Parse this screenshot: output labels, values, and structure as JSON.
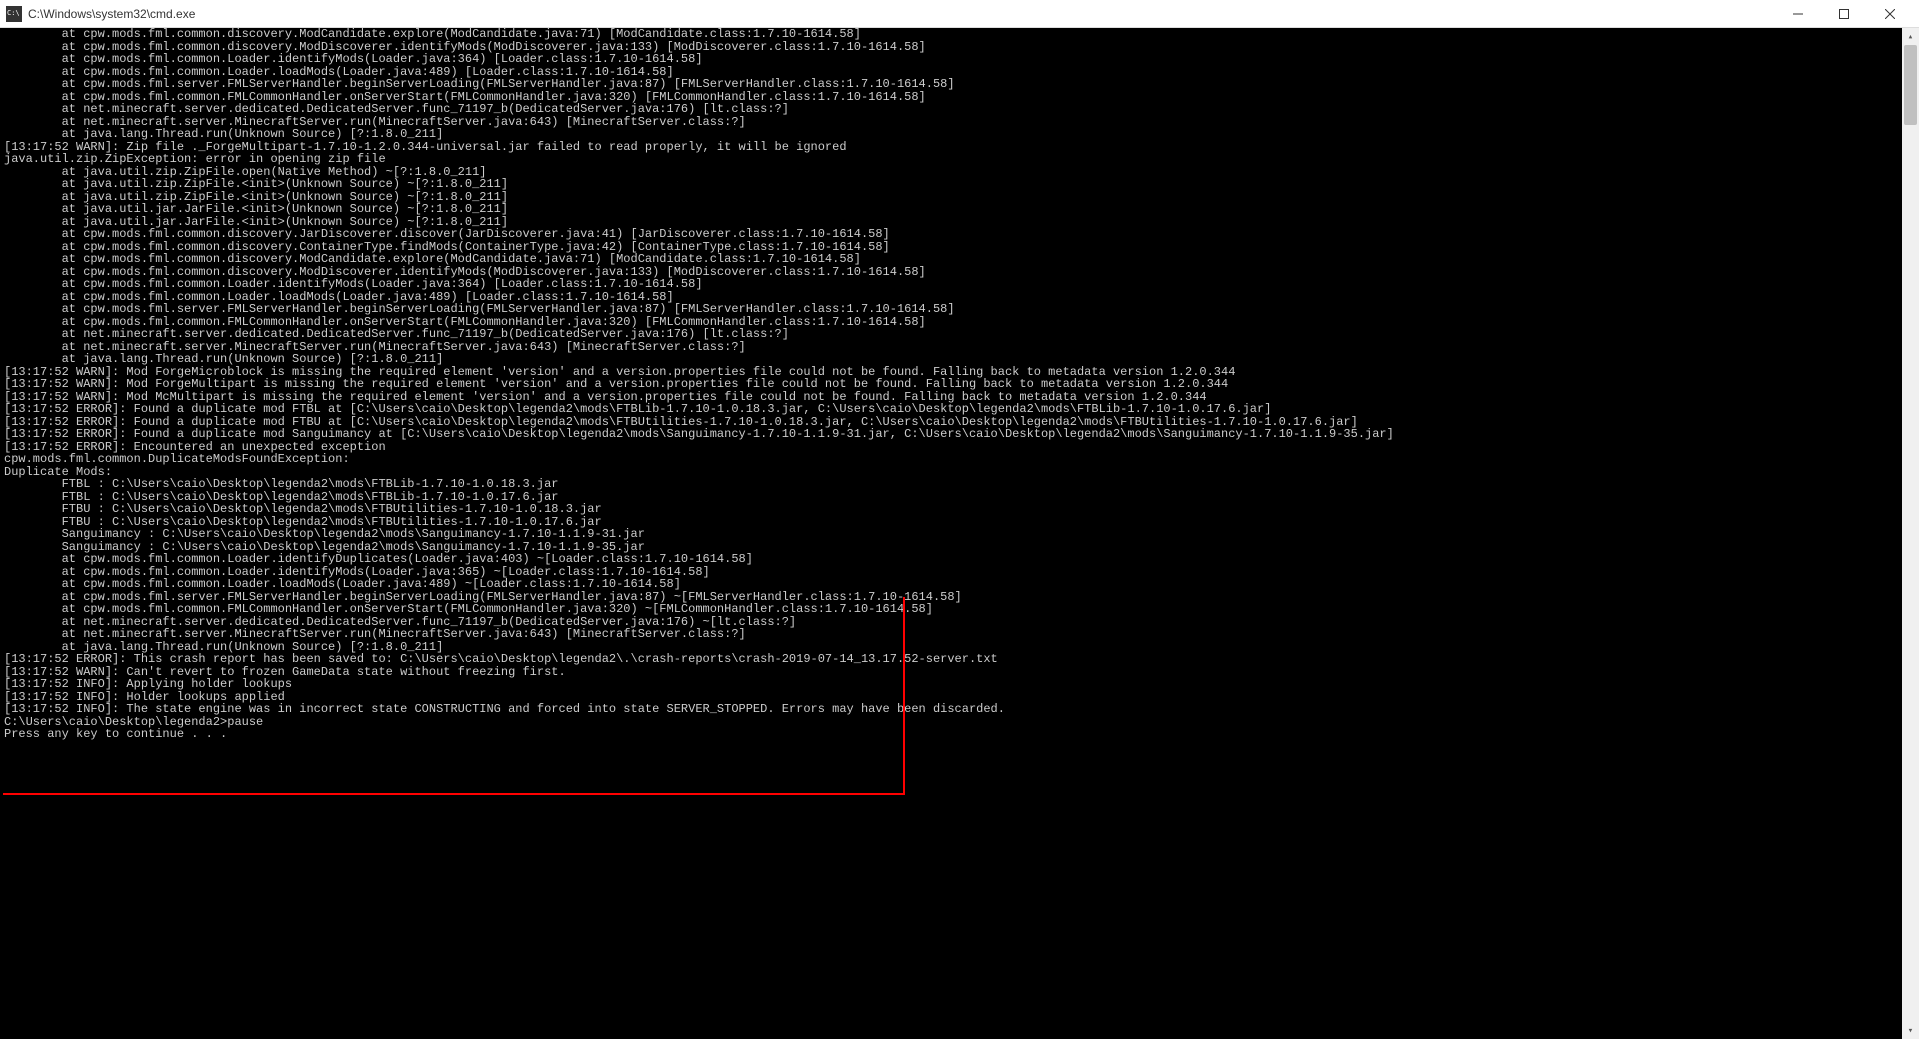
{
  "window": {
    "title": "C:\\Windows\\system32\\cmd.exe"
  },
  "log_lines": [
    "        at cpw.mods.fml.common.discovery.ModCandidate.explore(ModCandidate.java:71) [ModCandidate.class:1.7.10-1614.58]",
    "        at cpw.mods.fml.common.discovery.ModDiscoverer.identifyMods(ModDiscoverer.java:133) [ModDiscoverer.class:1.7.10-1614.58]",
    "        at cpw.mods.fml.common.Loader.identifyMods(Loader.java:364) [Loader.class:1.7.10-1614.58]",
    "        at cpw.mods.fml.common.Loader.loadMods(Loader.java:489) [Loader.class:1.7.10-1614.58]",
    "        at cpw.mods.fml.server.FMLServerHandler.beginServerLoading(FMLServerHandler.java:87) [FMLServerHandler.class:1.7.10-1614.58]",
    "        at cpw.mods.fml.common.FMLCommonHandler.onServerStart(FMLCommonHandler.java:320) [FMLCommonHandler.class:1.7.10-1614.58]",
    "        at net.minecraft.server.dedicated.DedicatedServer.func_71197_b(DedicatedServer.java:176) [lt.class:?]",
    "        at net.minecraft.server.MinecraftServer.run(MinecraftServer.java:643) [MinecraftServer.class:?]",
    "        at java.lang.Thread.run(Unknown Source) [?:1.8.0_211]",
    "[13:17:52 WARN]: Zip file ._ForgeMultipart-1.7.10-1.2.0.344-universal.jar failed to read properly, it will be ignored",
    "java.util.zip.ZipException: error in opening zip file",
    "        at java.util.zip.ZipFile.open(Native Method) ~[?:1.8.0_211]",
    "        at java.util.zip.ZipFile.<init>(Unknown Source) ~[?:1.8.0_211]",
    "        at java.util.zip.ZipFile.<init>(Unknown Source) ~[?:1.8.0_211]",
    "        at java.util.jar.JarFile.<init>(Unknown Source) ~[?:1.8.0_211]",
    "        at java.util.jar.JarFile.<init>(Unknown Source) ~[?:1.8.0_211]",
    "        at cpw.mods.fml.common.discovery.JarDiscoverer.discover(JarDiscoverer.java:41) [JarDiscoverer.class:1.7.10-1614.58]",
    "        at cpw.mods.fml.common.discovery.ContainerType.findMods(ContainerType.java:42) [ContainerType.class:1.7.10-1614.58]",
    "        at cpw.mods.fml.common.discovery.ModCandidate.explore(ModCandidate.java:71) [ModCandidate.class:1.7.10-1614.58]",
    "        at cpw.mods.fml.common.discovery.ModDiscoverer.identifyMods(ModDiscoverer.java:133) [ModDiscoverer.class:1.7.10-1614.58]",
    "        at cpw.mods.fml.common.Loader.identifyMods(Loader.java:364) [Loader.class:1.7.10-1614.58]",
    "        at cpw.mods.fml.common.Loader.loadMods(Loader.java:489) [Loader.class:1.7.10-1614.58]",
    "        at cpw.mods.fml.server.FMLServerHandler.beginServerLoading(FMLServerHandler.java:87) [FMLServerHandler.class:1.7.10-1614.58]",
    "        at cpw.mods.fml.common.FMLCommonHandler.onServerStart(FMLCommonHandler.java:320) [FMLCommonHandler.class:1.7.10-1614.58]",
    "        at net.minecraft.server.dedicated.DedicatedServer.func_71197_b(DedicatedServer.java:176) [lt.class:?]",
    "        at net.minecraft.server.MinecraftServer.run(MinecraftServer.java:643) [MinecraftServer.class:?]",
    "        at java.lang.Thread.run(Unknown Source) [?:1.8.0_211]",
    "[13:17:52 WARN]: Mod ForgeMicroblock is missing the required element 'version' and a version.properties file could not be found. Falling back to metadata version 1.2.0.344",
    "[13:17:52 WARN]: Mod ForgeMultipart is missing the required element 'version' and a version.properties file could not be found. Falling back to metadata version 1.2.0.344",
    "[13:17:52 WARN]: Mod McMultipart is missing the required element 'version' and a version.properties file could not be found. Falling back to metadata version 1.2.0.344",
    "[13:17:52 ERROR]: Found a duplicate mod FTBL at [C:\\Users\\caio\\Desktop\\legenda2\\mods\\FTBLib-1.7.10-1.0.18.3.jar, C:\\Users\\caio\\Desktop\\legenda2\\mods\\FTBLib-1.7.10-1.0.17.6.jar]",
    "[13:17:52 ERROR]: Found a duplicate mod FTBU at [C:\\Users\\caio\\Desktop\\legenda2\\mods\\FTBUtilities-1.7.10-1.0.18.3.jar, C:\\Users\\caio\\Desktop\\legenda2\\mods\\FTBUtilities-1.7.10-1.0.17.6.jar]",
    "[13:17:52 ERROR]: Found a duplicate mod Sanguimancy at [C:\\Users\\caio\\Desktop\\legenda2\\mods\\Sanguimancy-1.7.10-1.1.9-31.jar, C:\\Users\\caio\\Desktop\\legenda2\\mods\\Sanguimancy-1.7.10-1.1.9-35.jar]",
    "[13:17:52 ERROR]: Encountered an unexpected exception",
    "cpw.mods.fml.common.DuplicateModsFoundException:",
    "Duplicate Mods:",
    "        FTBL : C:\\Users\\caio\\Desktop\\legenda2\\mods\\FTBLib-1.7.10-1.0.18.3.jar",
    "        FTBL : C:\\Users\\caio\\Desktop\\legenda2\\mods\\FTBLib-1.7.10-1.0.17.6.jar",
    "        FTBU : C:\\Users\\caio\\Desktop\\legenda2\\mods\\FTBUtilities-1.7.10-1.0.18.3.jar",
    "        FTBU : C:\\Users\\caio\\Desktop\\legenda2\\mods\\FTBUtilities-1.7.10-1.0.17.6.jar",
    "        Sanguimancy : C:\\Users\\caio\\Desktop\\legenda2\\mods\\Sanguimancy-1.7.10-1.1.9-31.jar",
    "        Sanguimancy : C:\\Users\\caio\\Desktop\\legenda2\\mods\\Sanguimancy-1.7.10-1.1.9-35.jar",
    "",
    "",
    "        at cpw.mods.fml.common.Loader.identifyDuplicates(Loader.java:403) ~[Loader.class:1.7.10-1614.58]",
    "        at cpw.mods.fml.common.Loader.identifyMods(Loader.java:365) ~[Loader.class:1.7.10-1614.58]",
    "        at cpw.mods.fml.common.Loader.loadMods(Loader.java:489) ~[Loader.class:1.7.10-1614.58]",
    "        at cpw.mods.fml.server.FMLServerHandler.beginServerLoading(FMLServerHandler.java:87) ~[FMLServerHandler.class:1.7.10-1614.58]",
    "        at cpw.mods.fml.common.FMLCommonHandler.onServerStart(FMLCommonHandler.java:320) ~[FMLCommonHandler.class:1.7.10-1614.58]",
    "        at net.minecraft.server.dedicated.DedicatedServer.func_71197_b(DedicatedServer.java:176) ~[lt.class:?]",
    "        at net.minecraft.server.MinecraftServer.run(MinecraftServer.java:643) [MinecraftServer.class:?]",
    "        at java.lang.Thread.run(Unknown Source) [?:1.8.0_211]",
    "[13:17:52 ERROR]: This crash report has been saved to: C:\\Users\\caio\\Desktop\\legenda2\\.\\crash-reports\\crash-2019-07-14_13.17.52-server.txt",
    "[13:17:52 WARN]: Can't revert to frozen GameData state without freezing first.",
    "[13:17:52 INFO]: Applying holder lookups",
    "[13:17:52 INFO]: Holder lookups applied",
    "[13:17:52 INFO]: The state engine was in incorrect state CONSTRUCTING and forced into state SERVER_STOPPED. Errors may have been discarded.",
    "",
    "C:\\Users\\caio\\Desktop\\legenda2>pause",
    "Press any key to continue . . ."
  ]
}
